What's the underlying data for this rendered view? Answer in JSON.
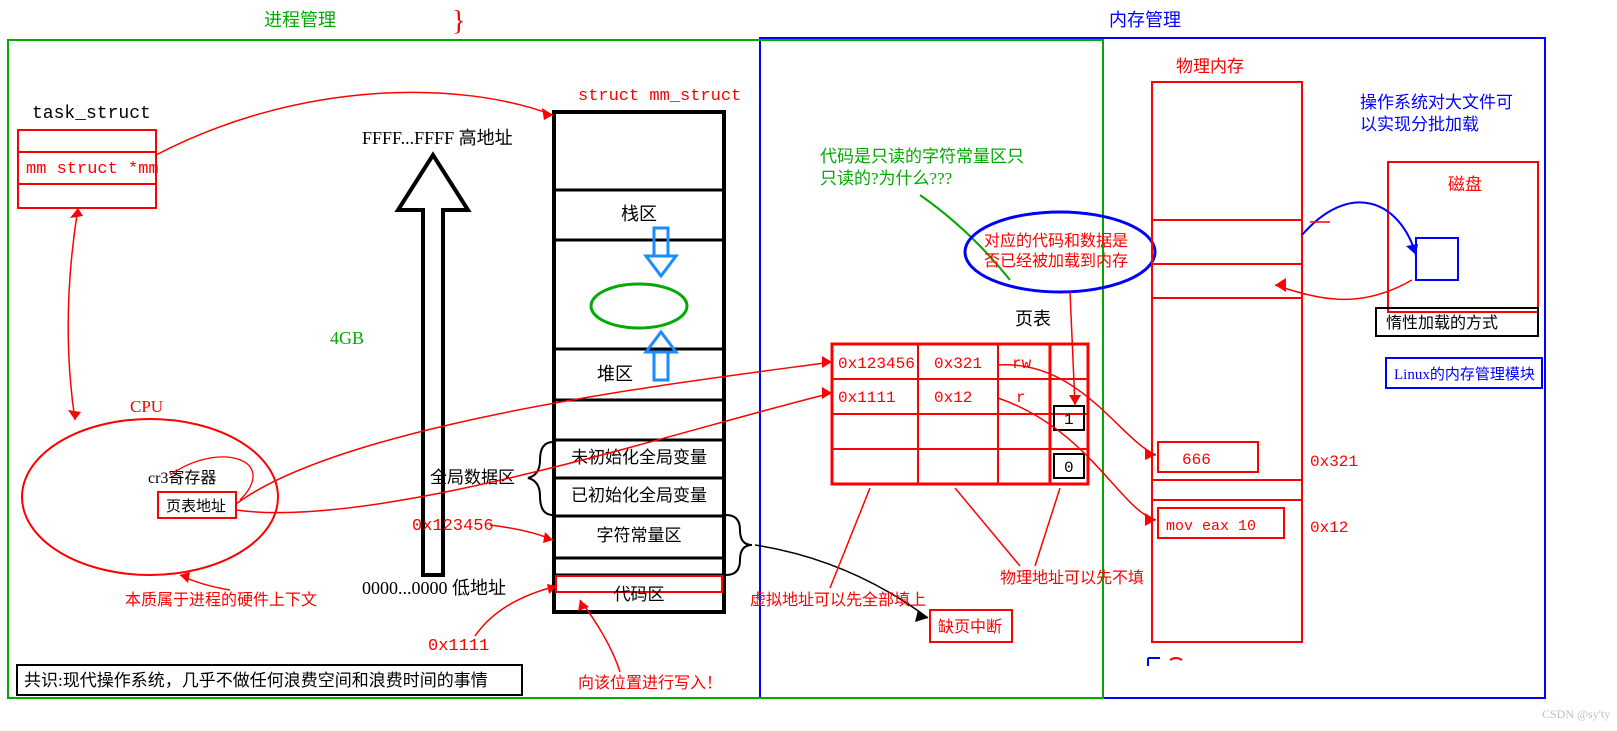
{
  "titles": {
    "process_mgmt": "进程管理",
    "memory_mgmt": "内存管理"
  },
  "task_struct": {
    "label": "task_struct",
    "field": "mm struct *mm"
  },
  "mm_struct": {
    "title": "struct mm_struct",
    "hi_addr": "FFFF...FFFF 高地址",
    "lo_addr": "0000...0000 低地址",
    "size_label": "4GB",
    "regions": {
      "stack": "栈区",
      "heap": "堆区",
      "global_label": "全局数据区",
      "uninit": "未初始化全局变量",
      "init": "已初始化全局变量",
      "const_str": "字符常量区",
      "code": "代码区"
    }
  },
  "cpu": {
    "label": "CPU",
    "reg_label": "cr3寄存器",
    "reg_content": "页表地址",
    "note": "本质属于进程的硬件上下文"
  },
  "addrs": {
    "a1": "0x123456",
    "a2": "0x1111",
    "write_note": "向该位置进行写入！"
  },
  "common_sense": "共识:现代操作系统，几乎不做任何浪费空间和浪费时间的事情",
  "page_table": {
    "title": "页表",
    "rows": [
      {
        "va": "0x123456",
        "pa": "0x321",
        "perm": "rw",
        "flag": ""
      },
      {
        "va": "0x1111",
        "pa": "0x12",
        "perm": "r",
        "flag": "1"
      },
      {
        "va": "",
        "pa": "",
        "perm": "",
        "flag": ""
      },
      {
        "va": "",
        "pa": "",
        "perm": "",
        "flag": "0"
      }
    ],
    "note_va": "虚拟地址可以先全部填上",
    "note_pa": "物理地址可以先不填",
    "page_fault": "缺页中断"
  },
  "readonly_q": "代码是只读的字符常量区只只读的?为什么???",
  "loaded_q": "对应的代码和数据是否已经被加载到内存",
  "phys_mem": {
    "title": "物理内存",
    "cell_666": "666",
    "addr_666": "0x321",
    "cell_mov": "mov eax 10",
    "addr_mov": "0x12"
  },
  "disk": {
    "title": "磁盘",
    "note1": "操作系统对大文件可以实现分批加载",
    "lazy": "惰性加载的方式",
    "linux_mm": "Linux的内存管理模块"
  },
  "watermark": "CSDN @sy'ty"
}
